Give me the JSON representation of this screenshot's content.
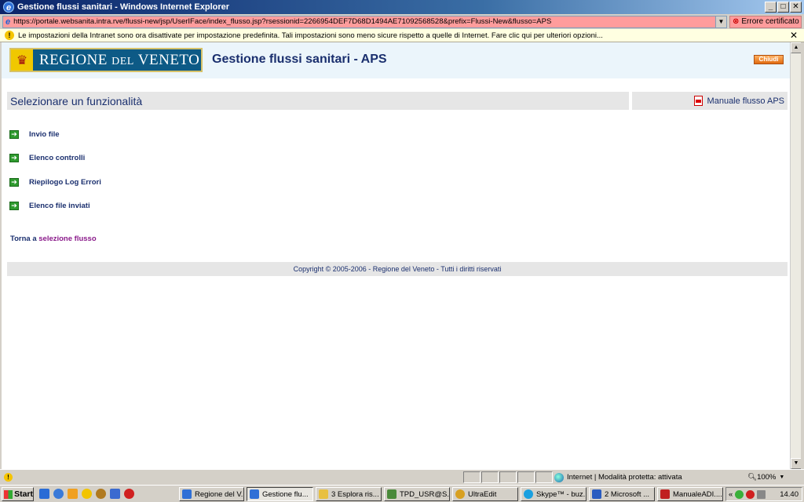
{
  "window": {
    "title": "Gestione flussi sanitari - Windows Internet Explorer",
    "minimize": "_",
    "maximize": "□",
    "close": "✕"
  },
  "addressbar": {
    "url": "https://portale.websanita.intra.rve/flussi-new/jsp/UserIFace/index_flusso.jsp?rsessionid=2266954DEF7D68D1494AE71092568528&prefix=Flussi-New&flusso=APS",
    "cert_error": "Errore certificato"
  },
  "infobar": {
    "message": "Le impostazioni della Intranet sono ora disattivate per impostazione predefinita. Tali impostazioni sono meno sicure rispetto a quelle di Internet. Fare clic qui per ulteriori opzioni...",
    "close": "✕"
  },
  "header": {
    "logo_main": "REGIONE ",
    "logo_del": "DEL",
    "logo_end": " VENETO",
    "app_title": "Gestione flussi sanitari - APS",
    "close_button": "Chiudi"
  },
  "section": {
    "title": "Selezionare un funzionalità",
    "manual_link": "Manuale flusso APS"
  },
  "menu": {
    "items": [
      {
        "label": "Invio file"
      },
      {
        "label": "Elenco controlli"
      },
      {
        "label": "Riepilogo Log Errori"
      },
      {
        "label": "Elenco file inviati"
      }
    ]
  },
  "back": {
    "prefix": "Torna a ",
    "link": "selezione flusso"
  },
  "footer": {
    "copyright": "Copyright © 2005-2006 - Regione del Veneto - Tutti i diritti riservati"
  },
  "statusbar": {
    "zone": "Internet | Modalità protetta: attivata",
    "zoom": "100%"
  },
  "taskbar": {
    "start": "Start",
    "tasks": [
      {
        "label": "Regione del V...",
        "color": "#2f6fd6",
        "active": false
      },
      {
        "label": "Gestione flu...",
        "color": "#2f6fd6",
        "active": true
      },
      {
        "label": "3 Esplora ris...",
        "color": "#e8c040",
        "active": false
      },
      {
        "label": "TPD_USR@S...",
        "color": "#4a8a3a",
        "active": false
      },
      {
        "label": "UltraEdit",
        "color": "#d8a020",
        "active": false
      },
      {
        "label": "Skype™ - buz...",
        "color": "#1aa0e0",
        "active": false
      },
      {
        "label": "2 Microsoft ...",
        "color": "#2a5cc0",
        "active": false
      },
      {
        "label": "ManualeADI....",
        "color": "#c02020",
        "active": false
      }
    ],
    "clock": "14.40"
  }
}
